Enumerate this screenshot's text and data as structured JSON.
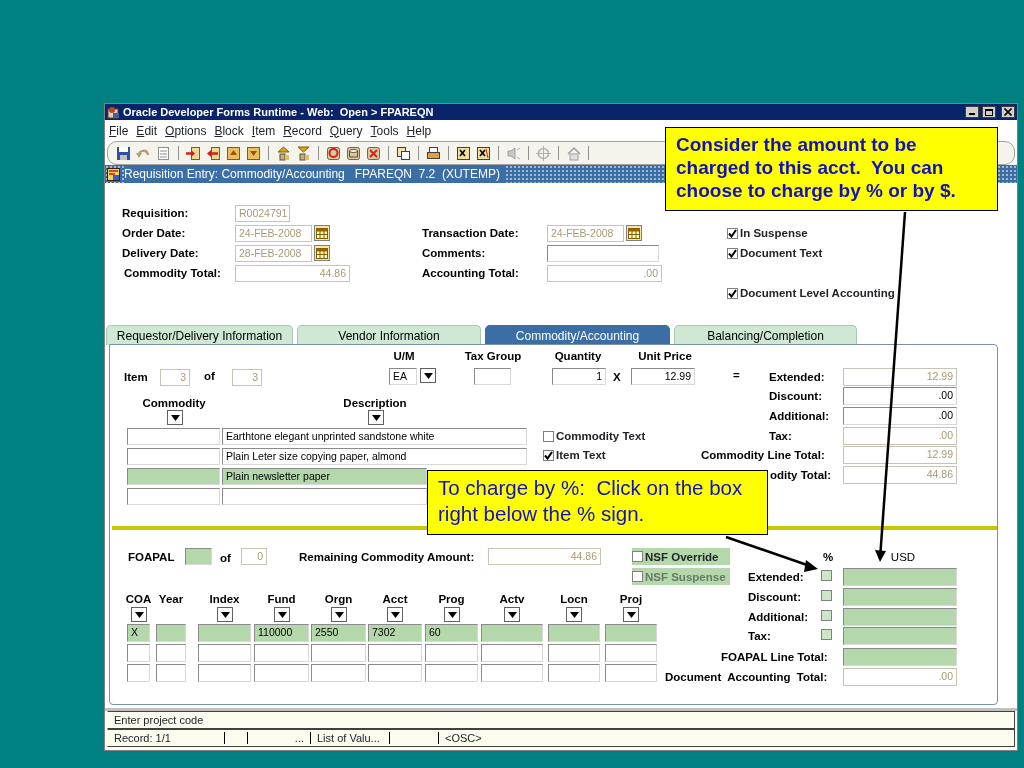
{
  "window": {
    "title": "Oracle Developer Forms Runtime - Web:  Open > FPAREQN"
  },
  "menu": [
    "File",
    "Edit",
    "Options",
    "Block",
    "Item",
    "Record",
    "Query",
    "Tools",
    "Help"
  ],
  "form_title": "Requisition Entry: Commodity/Accounting   FPAREQN  7.2  (XUTEMP)",
  "header": {
    "fields": [
      {
        "label": "Requisition:",
        "value": "R0024791",
        "disabled": true,
        "calendar": false
      },
      {
        "label": "Order Date:",
        "value": "24-FEB-2008",
        "disabled": true,
        "calendar": true
      },
      {
        "label": "Delivery Date:",
        "value": "28-FEB-2008",
        "disabled": true,
        "calendar": true
      },
      {
        "label": "Commodity Total:",
        "value": "44.86",
        "disabled": true,
        "calendar": false
      },
      {
        "label": "Transaction Date:",
        "value": "24-FEB-2008",
        "disabled": true,
        "calendar": true
      },
      {
        "label": "Comments:",
        "disabled": false,
        "calendar": false
      },
      {
        "label": "Accounting Total:",
        "value": ".00",
        "disabled": true,
        "calendar": false
      }
    ],
    "checks": [
      {
        "label": "In Suspense",
        "checked": true
      },
      {
        "label": "Document Text",
        "checked": true
      },
      {
        "label": "Document Level Accounting",
        "checked": true
      }
    ]
  },
  "tabs": [
    {
      "label": "Requestor/Delivery Information",
      "selected": false
    },
    {
      "label": "Vendor Information",
      "selected": false
    },
    {
      "label": "Commodity/Accounting",
      "selected": true
    },
    {
      "label": "Balancing/Completion",
      "selected": false
    }
  ],
  "commodity": {
    "item": {
      "label": "Item",
      "value": "3",
      "disabled": true
    },
    "of": {
      "label": "of",
      "value": "3",
      "disabled": true
    },
    "um": {
      "label": "U/M",
      "value": "EA",
      "disabled": false
    },
    "tax_group": {
      "label": "Tax Group",
      "disabled": false
    },
    "quantity": {
      "label": "Quantity",
      "value": "1",
      "disabled": false
    },
    "times": "X",
    "unit_price": {
      "label": "Unit Price",
      "value": "12.99",
      "disabled": false
    },
    "equals": "=",
    "columns": [
      "Commodity",
      "Description"
    ],
    "lines": [
      {
        "description": "Earthtone elegant unprinted sandstone white",
        "selected": false
      },
      {
        "description": "Plain Leter size copying paper, almond",
        "selected": false
      },
      {
        "description": "Plain newsletter paper",
        "selected": true
      },
      {
        "selected": false
      }
    ],
    "checks": [
      {
        "label": "Commodity Text",
        "checked": false
      },
      {
        "label": "Item Text",
        "checked": true
      }
    ],
    "amounts": [
      {
        "label": "Extended:",
        "value": "12.99",
        "disabled": true
      },
      {
        "label": "Discount:",
        "value": ".00",
        "disabled": false
      },
      {
        "label": "Additional:",
        "value": ".00",
        "disabled": false
      },
      {
        "label": "Tax:",
        "value": ".00",
        "disabled": true
      },
      {
        "label": "Commodity Line Total:",
        "value": "12.99",
        "disabled": true
      },
      {
        "label": "odity Total:",
        "value": "44.86",
        "disabled": true
      }
    ]
  },
  "accounting": {
    "foapal": {
      "label": "FOAPAL",
      "current": true
    },
    "of": {
      "label": "of",
      "value": "0",
      "disabled": true
    },
    "remaining": {
      "label": "Remaining Commodity Amount:",
      "value": "44.86",
      "disabled": true
    },
    "nsf": [
      {
        "label": "NSF Override",
        "checked": false,
        "disabled": false
      },
      {
        "label": "NSF Suspense",
        "checked": false,
        "disabled": true
      }
    ],
    "percent_heading": "%",
    "usd_heading": "USD",
    "amounts": [
      {
        "label": "Extended:",
        "kind": "percent",
        "checked": false,
        "current": true
      },
      {
        "label": "Discount:",
        "kind": "percent",
        "checked": false,
        "current": true
      },
      {
        "label": "Additional:",
        "kind": "percent",
        "checked": false,
        "current": true
      },
      {
        "label": "Tax:",
        "kind": "percent",
        "checked": false,
        "current": true
      },
      {
        "label": "FOAPAL Line Total:",
        "kind": "total",
        "current": true
      },
      {
        "label": "Document  Accounting  Total:",
        "kind": "total",
        "value": ".00",
        "disabled": true,
        "current": false
      }
    ],
    "columns": [
      {
        "label": "COA",
        "lov": true
      },
      {
        "label": "Year",
        "lov": false
      },
      {
        "label": "Index",
        "lov": true
      },
      {
        "label": "Fund",
        "lov": true
      },
      {
        "label": "Orgn",
        "lov": true
      },
      {
        "label": "Acct",
        "lov": true
      },
      {
        "label": "Prog",
        "lov": true
      },
      {
        "label": "Actv",
        "lov": true
      },
      {
        "label": "Locn",
        "lov": true
      },
      {
        "label": "Proj",
        "lov": true
      }
    ],
    "rows": [
      {
        "selected": true,
        "coa": "X",
        "fund": "110000",
        "orgn": "2550",
        "acct": "7302",
        "prog": "60"
      },
      {
        "selected": false
      },
      {
        "selected": false
      }
    ]
  },
  "status": {
    "message": "Enter project code",
    "record": "Record: 1/1",
    "ellipsis": "...",
    "lov": "List of Valu...",
    "osc": "<OSC>"
  },
  "callouts": [
    {
      "text": "Consider the amount to be charged to this acct.  You can choose to charge by % or by $.",
      "kind": "bold"
    },
    {
      "text": "To charge by %:  Click on the box right below the % sign.",
      "kind": "plain"
    }
  ]
}
